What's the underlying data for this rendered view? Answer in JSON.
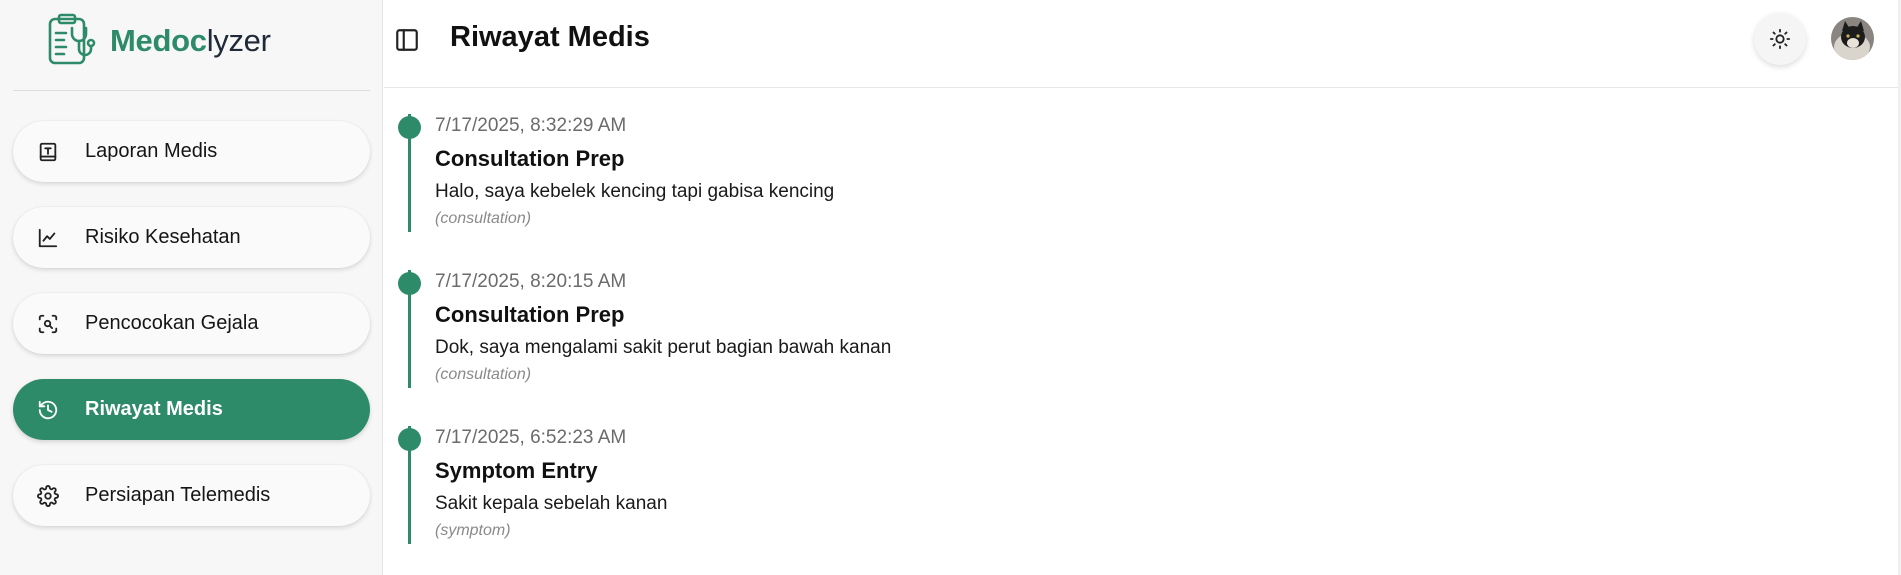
{
  "brand": {
    "part1": "Medoc",
    "part2": "lyzer",
    "color": "#2e8b6a"
  },
  "sidebar": {
    "items": [
      {
        "label": "Laporan Medis",
        "icon": "report-icon",
        "active": false
      },
      {
        "label": "Risiko Kesehatan",
        "icon": "line-chart-icon",
        "active": false
      },
      {
        "label": "Pencocokan Gejala",
        "icon": "scan-search-icon",
        "active": false
      },
      {
        "label": "Riwayat Medis",
        "icon": "history-icon",
        "active": true
      },
      {
        "label": "Persiapan Telemedis",
        "icon": "gear-icon",
        "active": false
      }
    ]
  },
  "header": {
    "title": "Riwayat Medis",
    "theme_icon": "sun-icon",
    "avatar": "user-avatar"
  },
  "timeline": {
    "entries": [
      {
        "date": "7/17/2025, 8:32:29 AM",
        "title": "Consultation Prep",
        "message": "Halo, saya kebelek kencing tapi gabisa kencing",
        "type": "(consultation)"
      },
      {
        "date": "7/17/2025, 8:20:15 AM",
        "title": "Consultation Prep",
        "message": "Dok, saya mengalami sakit perut bagian bawah kanan",
        "type": "(consultation)"
      },
      {
        "date": "7/17/2025, 6:52:23 AM",
        "title": "Symptom Entry",
        "message": "Sakit kepala sebelah kanan",
        "type": "(symptom)"
      }
    ]
  },
  "colors": {
    "accent": "#2e8b6a",
    "sidebar_bg": "#f7f7f7"
  }
}
